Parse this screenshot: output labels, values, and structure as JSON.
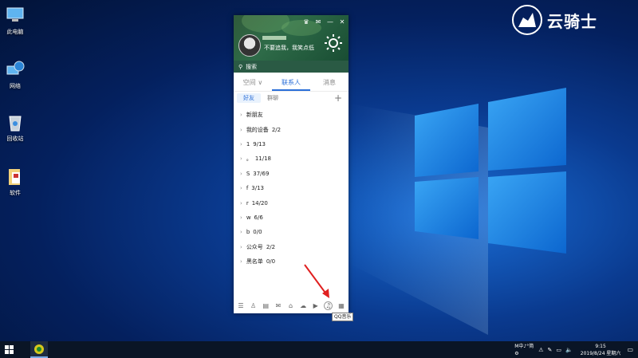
{
  "desktop": {
    "icons": [
      {
        "label": "此电脑",
        "icon": "computer-icon"
      },
      {
        "label": "网络",
        "icon": "network-icon"
      },
      {
        "label": "回收站",
        "icon": "recycle-bin-icon"
      },
      {
        "label": "软件",
        "icon": "folder-icon"
      }
    ],
    "watermark": "云骑士"
  },
  "qq": {
    "signature": "不要追我，我笑点低",
    "search_placeholder": "搜索",
    "tabs": [
      "空间",
      "联系人",
      "消息"
    ],
    "active_tab": "联系人",
    "subtabs": [
      "好友",
      "群聊"
    ],
    "active_subtab": "好友",
    "groups": [
      {
        "name": "新朋友",
        "count": ""
      },
      {
        "name": "我的设备",
        "count": "2/2"
      },
      {
        "name": "1",
        "count": "9/13"
      },
      {
        "name": "。",
        "count": "11/18"
      },
      {
        "name": "S",
        "count": "37/69"
      },
      {
        "name": "f",
        "count": "3/13"
      },
      {
        "name": "r",
        "count": "14/20"
      },
      {
        "name": "w",
        "count": "6/6"
      },
      {
        "name": "b",
        "count": "0/0"
      },
      {
        "name": "公众号",
        "count": "2/2"
      },
      {
        "name": "黑名单",
        "count": "0/0"
      }
    ],
    "tooltip": "QQ音乐",
    "colors": {
      "accent": "#2b6fd8",
      "header": "#2e6b48"
    }
  },
  "taskbar": {
    "ime": [
      "M中♪°简",
      "⚙"
    ],
    "time": "9:15",
    "date": "2019/8/24 星期六"
  }
}
